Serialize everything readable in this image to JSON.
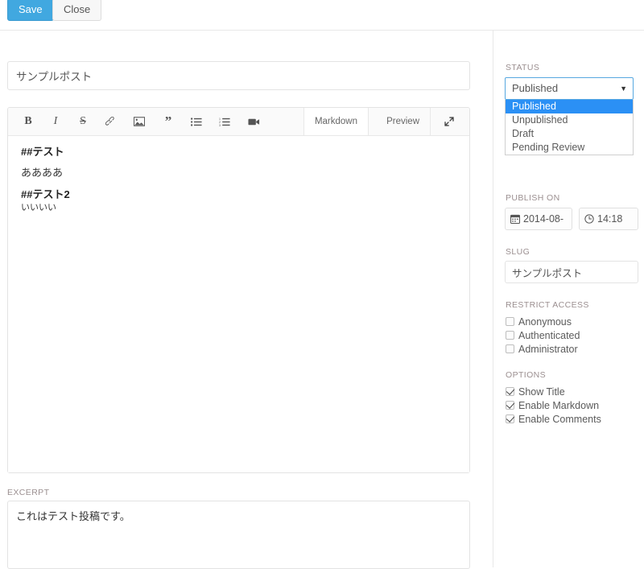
{
  "toolbar_top": {
    "save_label": "Save",
    "close_label": "Close"
  },
  "post": {
    "title_value": "サンプルポスト",
    "title_placeholder": "Title",
    "excerpt_label": "EXCERPT",
    "excerpt_value": "これはテスト投稿です。"
  },
  "editor": {
    "buttons": [
      {
        "name": "bold-icon",
        "label": "B"
      },
      {
        "name": "italic-icon",
        "label": "I"
      },
      {
        "name": "strikethrough-icon",
        "label": "S"
      },
      {
        "name": "link-icon",
        "label": "link"
      },
      {
        "name": "image-icon",
        "label": "image"
      },
      {
        "name": "quote-icon",
        "label": "quote"
      },
      {
        "name": "unordered-list-icon",
        "label": "ul"
      },
      {
        "name": "ordered-list-icon",
        "label": "ol"
      },
      {
        "name": "video-icon",
        "label": "video"
      }
    ],
    "tab_markdown": "Markdown",
    "tab_preview": "Preview",
    "expand_icon": "expand-icon",
    "content_lines": [
      "##テスト",
      "ああああ",
      "##テスト2",
      "いいいい"
    ]
  },
  "sidebar": {
    "status": {
      "label": "STATUS",
      "selected": "Published",
      "caret_icon": "chevron-down-icon",
      "options": [
        "Published",
        "Unpublished",
        "Draft",
        "Pending Review"
      ],
      "highlight_color": "#2b90f5",
      "focus_border_color": "#57a8e0"
    },
    "publish_on": {
      "label": "PUBLISH ON",
      "date_value": "2014-08-",
      "date_icon": "calendar-icon",
      "time_value": "14:18",
      "time_icon": "clock-icon"
    },
    "slug": {
      "label": "SLUG",
      "value": "サンプルポスト"
    },
    "restrict_access": {
      "label": "RESTRICT ACCESS",
      "items": [
        {
          "label": "Anonymous",
          "checked": false
        },
        {
          "label": "Authenticated",
          "checked": false
        },
        {
          "label": "Administrator",
          "checked": false
        }
      ]
    },
    "options": {
      "label": "OPTIONS",
      "items": [
        {
          "label": "Show Title",
          "checked": true
        },
        {
          "label": "Enable Markdown",
          "checked": true
        },
        {
          "label": "Enable Comments",
          "checked": true
        }
      ]
    }
  },
  "colors": {
    "primary": "#41a8e0",
    "border": "#e3e3e3",
    "label": "#9b8f90"
  }
}
